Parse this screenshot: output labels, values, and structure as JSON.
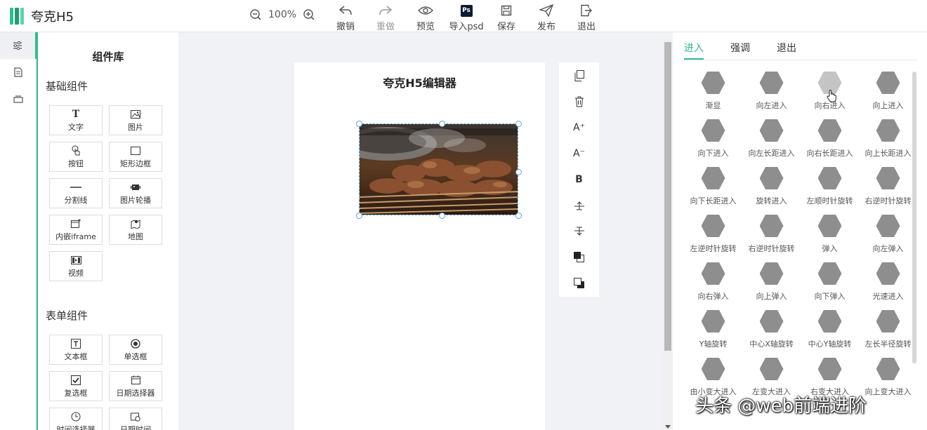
{
  "app": {
    "title": "夸克H5"
  },
  "zoom": {
    "level": "100%"
  },
  "toolbar": {
    "undo": "撤销",
    "redo": "重做",
    "preview": "预览",
    "import_psd": "导入psd",
    "ps_badge": "Ps",
    "save": "保存",
    "publish": "发布",
    "exit": "退出"
  },
  "library": {
    "title": "组件库",
    "basic": {
      "title": "基础组件",
      "items": [
        "文字",
        "图片",
        "按钮",
        "矩形边框",
        "分割线",
        "图片轮播",
        "内嵌iframe",
        "地图",
        "视频"
      ]
    },
    "form": {
      "title": "表单组件",
      "items": [
        "文本框",
        "单选框",
        "复选框",
        "日期选择器",
        "时间选择器",
        "日期时间"
      ]
    }
  },
  "canvas": {
    "title": "夸克H5编辑器"
  },
  "vtoolbar": {
    "bold": "B",
    "font_up": "A⁺",
    "font_down": "A⁻"
  },
  "animations": {
    "tabs": [
      "进入",
      "强调",
      "退出"
    ],
    "items": [
      "渐显",
      "向左进入",
      "向右进入",
      "向上进入",
      "向下进入",
      "向左长距进入",
      "向右长距进入",
      "向上长距进入",
      "向下长距进入",
      "旋转进入",
      "左顺时针旋转",
      "右逆时针旋转",
      "左逆时针旋转",
      "右逆时针旋转",
      "弹入",
      "向左弹入",
      "向右弹入",
      "向上弹入",
      "向下弹入",
      "光速进入",
      "Y轴旋转",
      "中心X轴旋转",
      "中心Y轴旋转",
      "左长半径旋转",
      "由小变大进入",
      "左变大进入",
      "右变大进入",
      "向上变大进入"
    ]
  },
  "watermark": {
    "text": "头条 @web前端进阶"
  },
  "colors": {
    "accent": "#2fbf8a",
    "hex": "#8e8e8e"
  }
}
